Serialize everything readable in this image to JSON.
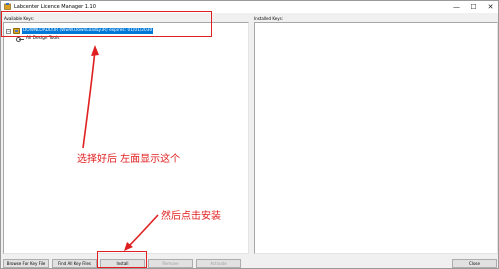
{
  "window": {
    "title": "Labcenter Licence Manager 1.10",
    "controls": {
      "minimize": "—",
      "maximize": "☐",
      "close": "✕"
    }
  },
  "available": {
    "label": "Available Keys:",
    "tree": {
      "expander": "−",
      "root_label": "DOWNLOADLY.IR (WwW.DownLoadLy.iR) expires: 01/01/2030",
      "child_label": "All Design Tools"
    }
  },
  "installed": {
    "label": "Installed Keys:"
  },
  "buttons": {
    "browse": "Browse For Key File",
    "find_all": "Find All Key Files",
    "install": "Install",
    "remove": "Remove",
    "activate": "Activate",
    "close": "Close"
  },
  "annotations": {
    "select_note": "选择好后 左面显示这个",
    "install_note": "然后点击安装",
    "color": "#e02020"
  }
}
